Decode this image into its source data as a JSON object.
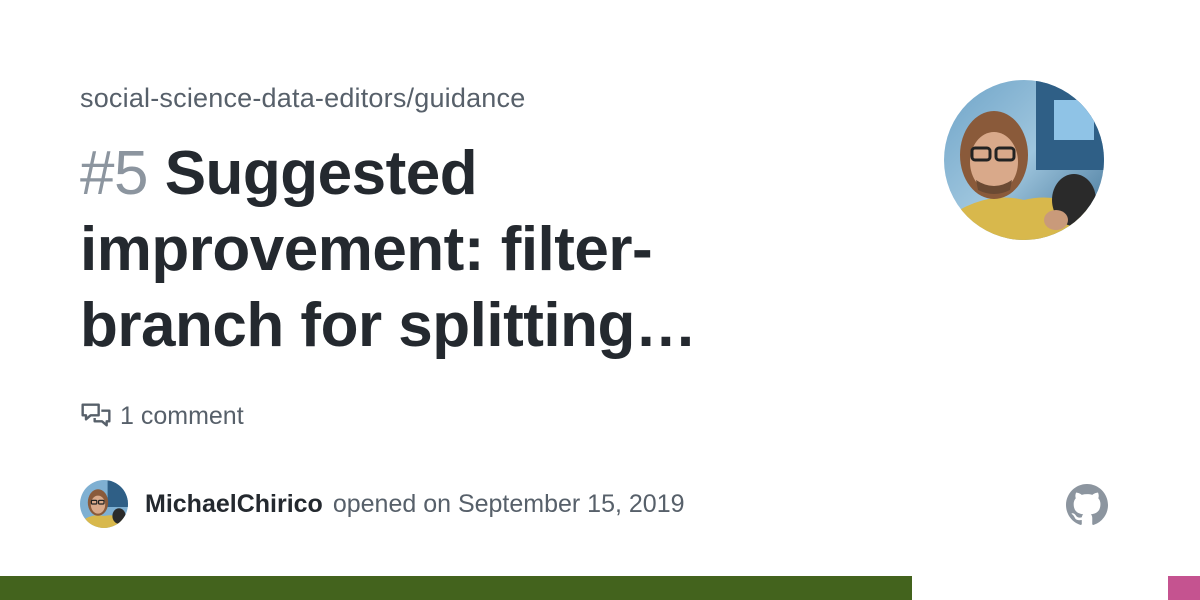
{
  "repo": {
    "full_name": "social-science-data-editors/guidance"
  },
  "issue": {
    "number": "#5",
    "title_lines": [
      "Suggested",
      "improvement: filter-",
      "branch for splitting…"
    ]
  },
  "stats": {
    "comments_label": "1 comment",
    "comments_icon": "comment-discussion-icon"
  },
  "author": {
    "username": "MichaelChirico",
    "opened_text": "opened on September 15, 2019"
  },
  "brand": {
    "logo_icon": "github-mark-icon"
  },
  "colors": {
    "title": "#24292f",
    "muted": "#57606a",
    "number": "#8c959f"
  },
  "language_bar": [
    {
      "color": "#43631d",
      "share": 0.76
    },
    {
      "color": "#ffffff",
      "share": 0.2133
    },
    {
      "color": "#c55390",
      "share": 0.0267
    }
  ]
}
